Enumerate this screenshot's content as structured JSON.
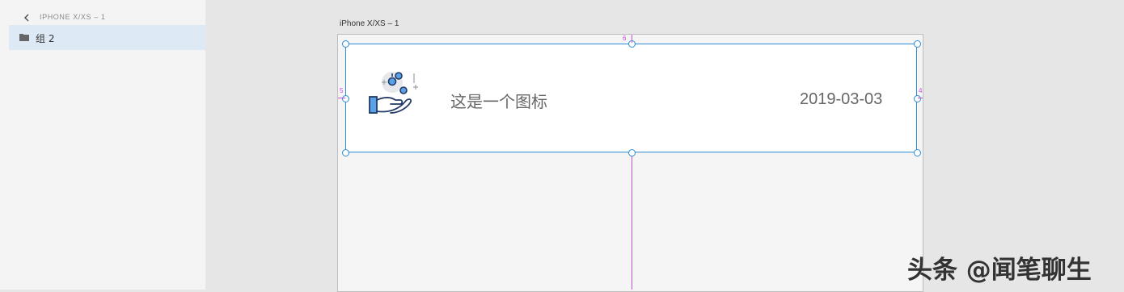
{
  "layers_panel": {
    "breadcrumb": "IPHONE X/XS – 1",
    "back_icon": "chevron-left-icon",
    "items": [
      {
        "label": "组 2",
        "icon": "folder-icon",
        "selected": true
      }
    ]
  },
  "artboard": {
    "label": "iPhone X/XS – 1"
  },
  "card": {
    "icon": "hand-with-coins-icon",
    "title": "这是一个图标",
    "date": "2019-03-03"
  },
  "spacing_labels": {
    "top": "6",
    "left": "5",
    "right": "4"
  },
  "colors": {
    "selection": "#2d8cd4",
    "guide": "#c94de0",
    "selected_row": "#dde9f4"
  },
  "watermark": "头条 @闻笔聊生"
}
